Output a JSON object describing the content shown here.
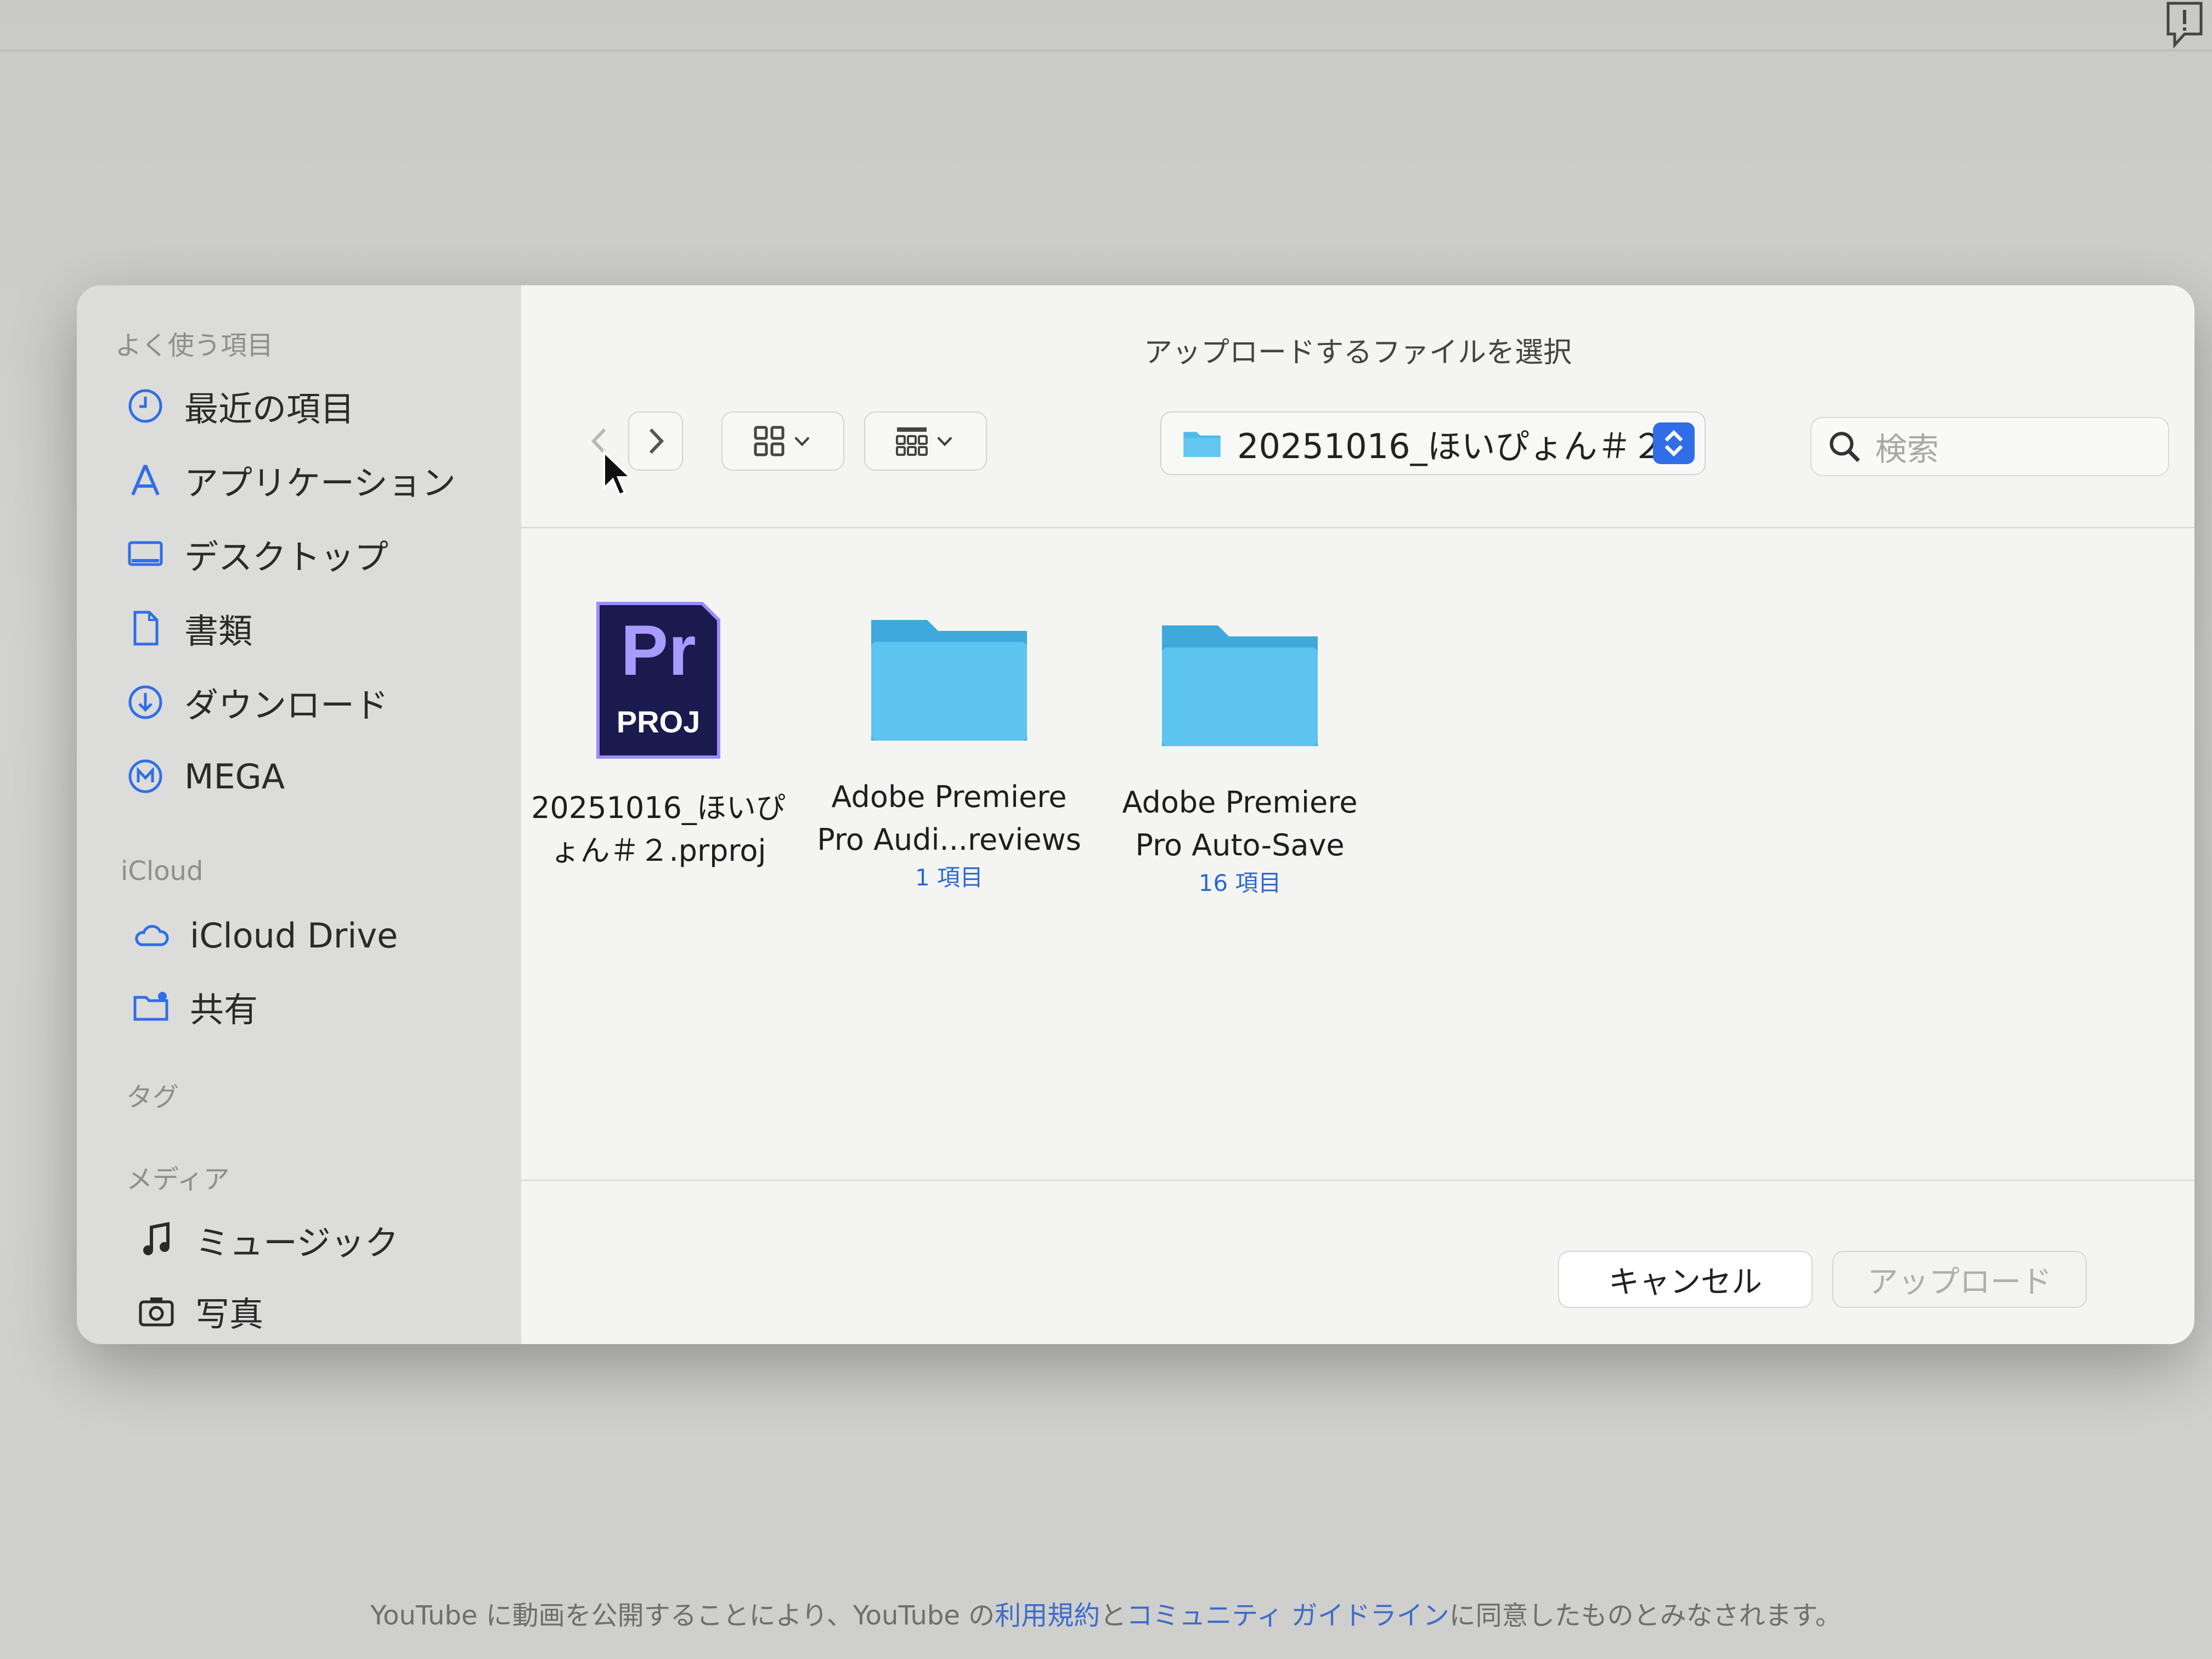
{
  "dialog": {
    "title": "アップロードするファイルを選択",
    "toolbar": {
      "back_icon": "chevron-left-icon",
      "forward_icon": "chevron-right-icon",
      "view_icon": "grid-view-icon",
      "group_icon": "group-view-icon",
      "current_folder": "20251016_ほいぴょん＃２",
      "search_placeholder": "検索"
    },
    "sidebar": {
      "favorites_header": "よく使う項目",
      "favorites": [
        {
          "label": "最近の項目",
          "icon": "clock-icon"
        },
        {
          "label": "アプリケーション",
          "icon": "apps-icon"
        },
        {
          "label": "デスクトップ",
          "icon": "desktop-icon"
        },
        {
          "label": "書類",
          "icon": "document-icon"
        },
        {
          "label": "ダウンロード",
          "icon": "download-icon"
        },
        {
          "label": "MEGA",
          "icon": "mega-icon"
        }
      ],
      "icloud_header": "iCloud",
      "icloud": [
        {
          "label": "iCloud Drive",
          "icon": "cloud-icon"
        },
        {
          "label": "共有",
          "icon": "shared-folder-icon"
        }
      ],
      "tags_header": "タグ",
      "media_header": "メディア",
      "media": [
        {
          "label": "ミュージック",
          "icon": "music-icon"
        },
        {
          "label": "写真",
          "icon": "camera-icon"
        }
      ]
    },
    "files": [
      {
        "name_line1": "20251016_ほいぴ",
        "name_line2": "ょん＃２.prproj",
        "icon_top": "Pr",
        "icon_bottom": "PROJ",
        "count": ""
      },
      {
        "name_line1": "Adobe Premiere",
        "name_line2": "Pro Audi...reviews",
        "count": "1 項目"
      },
      {
        "name_line1": "Adobe Premiere",
        "name_line2": "Pro Auto-Save",
        "count": "16 項目"
      }
    ],
    "buttons": {
      "cancel": "キャンセル",
      "upload": "アップロード"
    }
  },
  "footer": {
    "prefix": "YouTube に動画を公開することにより、YouTube の",
    "terms": "利用規約",
    "and": "と",
    "guidelines": "コミュニティ ガイドライン",
    "suffix": "に同意したものとみなされます。"
  },
  "colors": {
    "accent": "#2f6ee6",
    "folder": "#4fb9e8",
    "premiere": "#1a1a4e"
  }
}
